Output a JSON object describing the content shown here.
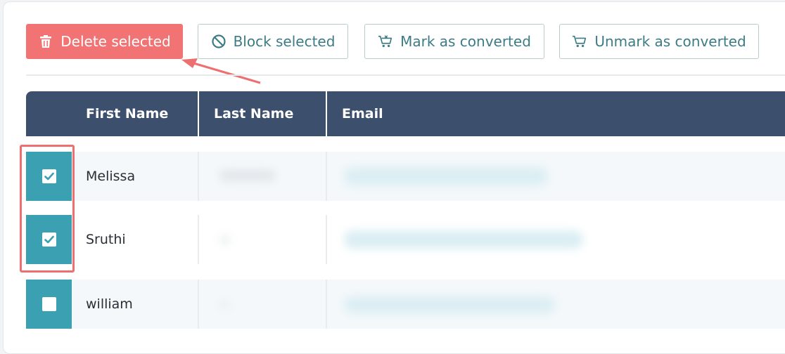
{
  "toolbar": {
    "delete_label": "Delete selected",
    "block_label": "Block selected",
    "mark_label": "Mark as converted",
    "unmark_label": "Unmark as converted"
  },
  "table": {
    "columns": [
      "First Name",
      "Last Name",
      "Email"
    ],
    "rows": [
      {
        "first_name": "Melissa",
        "checked": true
      },
      {
        "first_name": "Sruthi",
        "checked": true
      },
      {
        "first_name": "william",
        "checked": false
      }
    ]
  },
  "colors": {
    "accent_danger": "#f27373",
    "accent_teal": "#3ba0b2",
    "header_bg": "#3c506d",
    "button_text": "#3d7b85"
  },
  "icons": {
    "delete": "trash-icon",
    "block": "block-icon",
    "mark": "cart-x-icon",
    "unmark": "cart-icon",
    "checkbox": "checkmark-icon"
  }
}
